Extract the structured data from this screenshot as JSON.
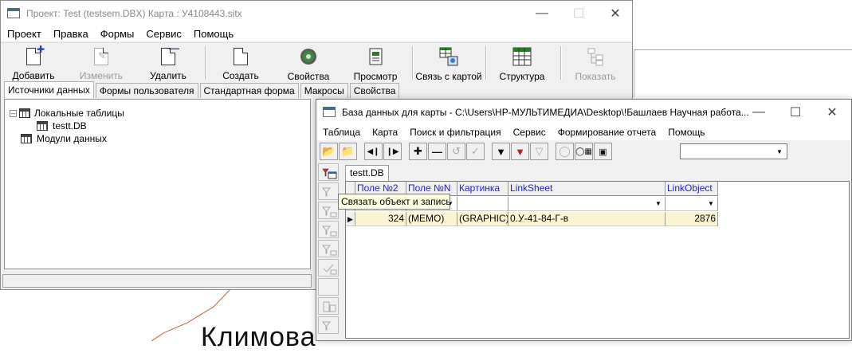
{
  "window1": {
    "title": "Проект: Test (testsem.DBX)   Карта : У4108443.sitx",
    "menu": [
      "Проект",
      "Правка",
      "Формы",
      "Сервис",
      "Помощь"
    ],
    "toolbar": {
      "add": "Добавить",
      "edit": "Изменить",
      "delete": "Удалить",
      "create": "Создать",
      "properties": "Свойства",
      "preview": "Просмотр",
      "map_link": "Связь с картой",
      "structure": "Структура",
      "show": "Показать"
    },
    "tabs": [
      "Источники данных",
      "Формы пользователя",
      "Стандартная форма",
      "Макросы",
      "Свойства"
    ],
    "tree": {
      "local_tables": "Локальные таблицы",
      "table_item": "testt.DB",
      "data_modules": "Модули данных"
    }
  },
  "window2": {
    "title": "База данных для карты - C:\\Users\\HP-МУЛЬТИМЕДИА\\Desktop\\!Башлаев Научная работа...",
    "menu": [
      "Таблица",
      "Карта",
      "Поиск и фильтрация",
      "Сервис",
      "Формирование отчета",
      "Помощь"
    ],
    "tab": "testt.DB",
    "columns": [
      "Поле №2",
      "Поле №N",
      "Картинка",
      "LinkSheet",
      "LinkObject"
    ],
    "rows": [
      [
        "324",
        "(MEMO)",
        "(GRAPHIC)",
        "0.У-41-84-Г-в",
        "2876"
      ]
    ],
    "tooltip": "Связать объект и запись"
  },
  "background": {
    "partial_text": "Климова"
  },
  "colors": {
    "header_text": "#1f1fc8",
    "row_highlight": "#fbf5d6",
    "tooltip_bg": "#ffffe1"
  }
}
